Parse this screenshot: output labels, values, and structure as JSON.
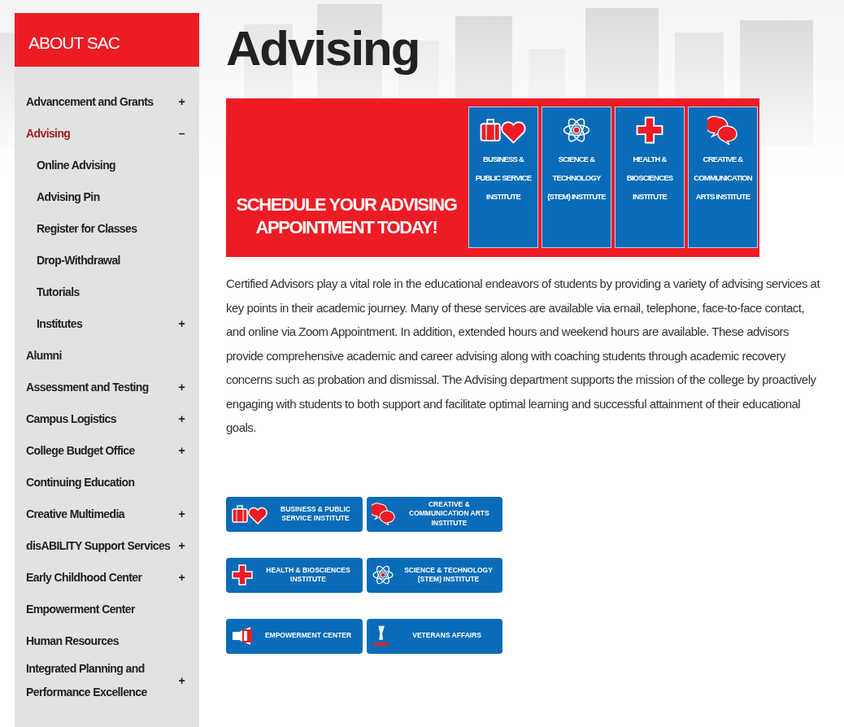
{
  "sidebar": {
    "title": "ABOUT SAC",
    "items": [
      {
        "label": "Advancement and Grants",
        "toggle": "+",
        "selected": false
      },
      {
        "label": "Advising",
        "toggle": "–",
        "selected": true,
        "children": [
          {
            "label": "Online Advising",
            "selected": false
          },
          {
            "label": "Advising Pin",
            "selected": false
          },
          {
            "label": "Register for Classes",
            "selected": false
          },
          {
            "label": "Drop-Withdrawal",
            "selected": false
          },
          {
            "label": "Tutorials",
            "selected": false
          },
          {
            "label": "Institutes",
            "toggle": "+",
            "selected": false
          }
        ]
      },
      {
        "label": "Alumni",
        "selected": false
      },
      {
        "label": "Assessment and Testing",
        "toggle": "+",
        "selected": false
      },
      {
        "label": "Campus Logistics",
        "toggle": "+",
        "selected": false
      },
      {
        "label": "College Budget Office",
        "toggle": "+",
        "selected": false
      },
      {
        "label": "Continuing Education",
        "selected": false
      },
      {
        "label": "Creative Multimedia",
        "toggle": "+",
        "selected": false
      },
      {
        "label": "disABILITY Support Services",
        "toggle": "+",
        "selected": false
      },
      {
        "label": "Early Childhood Center",
        "toggle": "+",
        "selected": false
      },
      {
        "label": "Empowerment Center",
        "selected": false
      },
      {
        "label": "Human Resources",
        "selected": false
      },
      {
        "label": "Integrated Planning and Performance Excellence",
        "toggle": "+",
        "selected": false
      }
    ]
  },
  "page_title": "Advising",
  "banner": {
    "headline": "SCHEDULE YOUR ADVISING APPOINTMENT TODAY!",
    "tiles": [
      {
        "label": "BUSINESS & PUBLIC SERVICE INSTITUTE",
        "kind": "business"
      },
      {
        "label": "SCIENCE & TECHNOLOGY (STEM) INSTITUTE",
        "kind": "science"
      },
      {
        "label": "HEALTH & BIOSCIENCES INSTITUTE",
        "kind": "health"
      },
      {
        "label": "CREATIVE & COMMUNICATION ARTS INSTITUTE",
        "kind": "creative"
      }
    ]
  },
  "intro": "Certified Advisors play a vital role in the educational endeavors of students by providing a variety of advising services at key points in their academic journey. Many of these services are available via email, telephone, face-to-face contact, and online via Zoom Appointment. In addition, extended hours and weekend hours are available. These advisors provide comprehensive academic and career advising along with coaching students through academic recovery concerns such as probation and dismissal. The Advising department supports the mission of the college by proactively engaging with students to both support and facilitate optimal learning and successful attainment of their educational goals.",
  "link_buttons": [
    {
      "label": "BUSINESS & PUBLIC SERVICE INSTITUTE",
      "kind": "business"
    },
    {
      "label": "CREATIVE & COMMUNICATION ARTS INSTITUTE",
      "kind": "creative"
    },
    {
      "label": "HEALTH & BIOSCIENCES INSTITUTE",
      "kind": "health"
    },
    {
      "label": "SCIENCE & TECHNOLOGY (STEM) INSTITUTE",
      "kind": "science"
    },
    {
      "label": "EMPOWERMENT CENTER",
      "kind": "empowerment"
    },
    {
      "label": "VETERANS AFFAIRS",
      "kind": "veterans"
    }
  ]
}
